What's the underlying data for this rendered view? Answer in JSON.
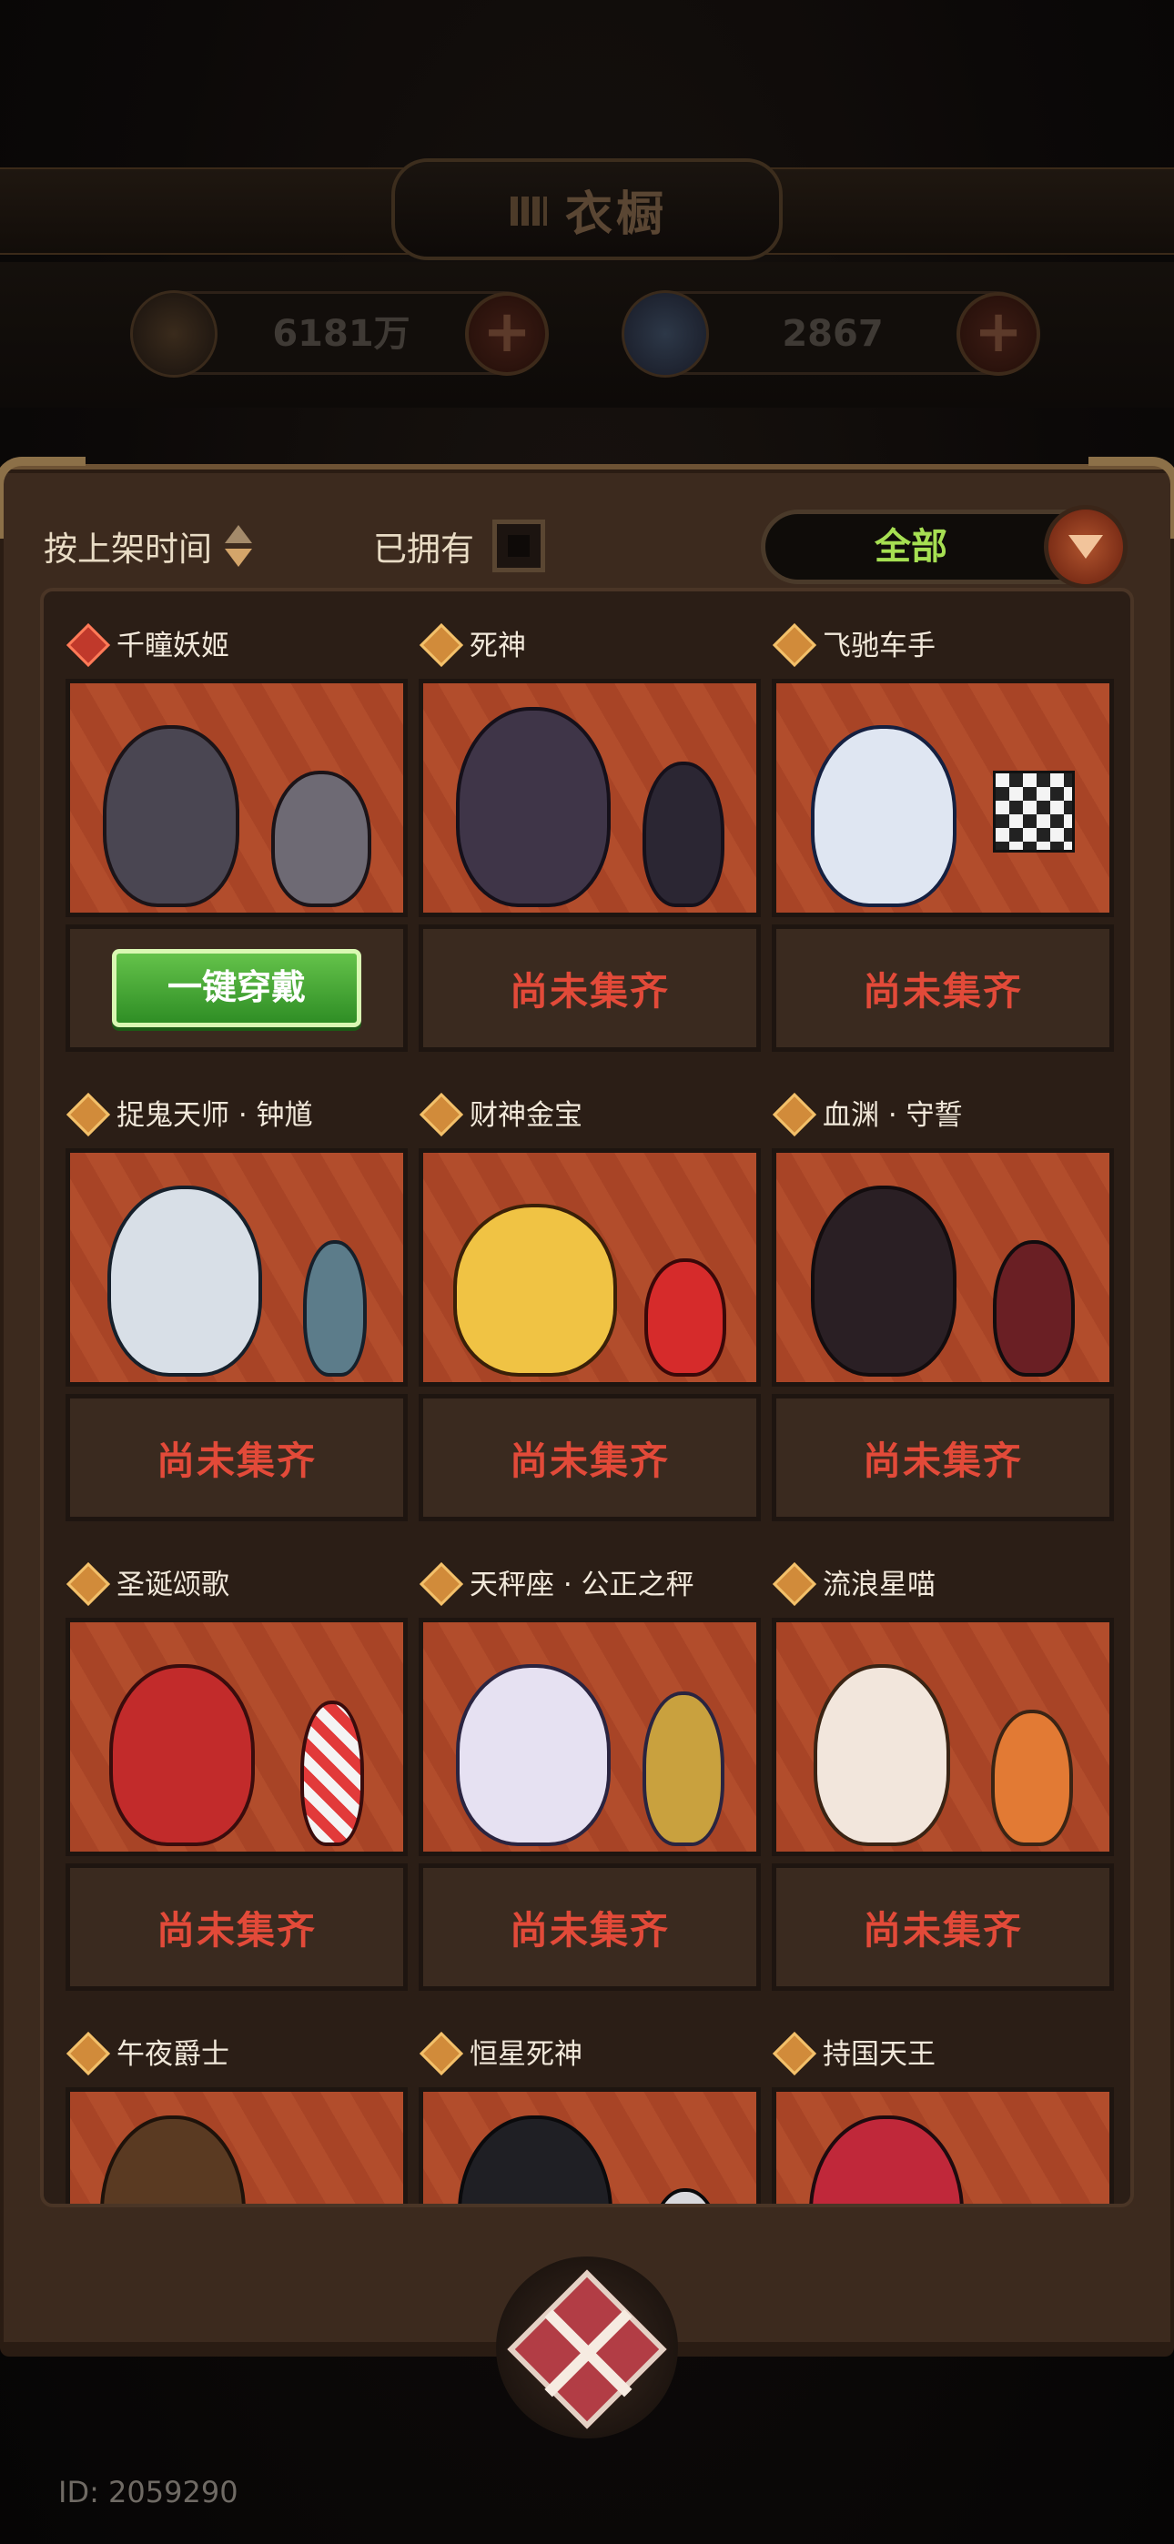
{
  "header": {
    "title": "衣橱",
    "currencies": [
      {
        "icon": "coin-icon",
        "value": "6181万"
      },
      {
        "icon": "gem-icon",
        "value": "2867"
      }
    ]
  },
  "filters": {
    "sort_label": "按上架时间",
    "owned_label": "已拥有",
    "dropdown_value": "全部"
  },
  "cards": [
    {
      "name": "千瞳妖姬",
      "rarity": "red",
      "status": "一键穿戴",
      "action": "wear"
    },
    {
      "name": "死神",
      "rarity": "orange",
      "status": "尚未集齐",
      "action": "incomplete"
    },
    {
      "name": "飞驰车手",
      "rarity": "orange",
      "status": "尚未集齐",
      "action": "incomplete"
    },
    {
      "name": "捉鬼天师 · 钟馗",
      "rarity": "orange",
      "status": "尚未集齐",
      "action": "incomplete"
    },
    {
      "name": "财神金宝",
      "rarity": "orange",
      "status": "尚未集齐",
      "action": "incomplete"
    },
    {
      "name": "血渊 · 守誓",
      "rarity": "orange",
      "status": "尚未集齐",
      "action": "incomplete"
    },
    {
      "name": "圣诞颂歌",
      "rarity": "orange",
      "status": "尚未集齐",
      "action": "incomplete"
    },
    {
      "name": "天秤座 · 公正之秤",
      "rarity": "orange",
      "status": "尚未集齐",
      "action": "incomplete"
    },
    {
      "name": "流浪星喵",
      "rarity": "orange",
      "status": "尚未集齐",
      "action": "incomplete"
    },
    {
      "name": "午夜爵士",
      "rarity": "orange",
      "status": "",
      "action": "none"
    },
    {
      "name": "恒星死神",
      "rarity": "orange",
      "status": "",
      "action": "none"
    },
    {
      "name": "持国天王",
      "rarity": "orange",
      "status": "",
      "action": "none"
    }
  ],
  "footer": {
    "id_text": "ID: 2059290"
  }
}
